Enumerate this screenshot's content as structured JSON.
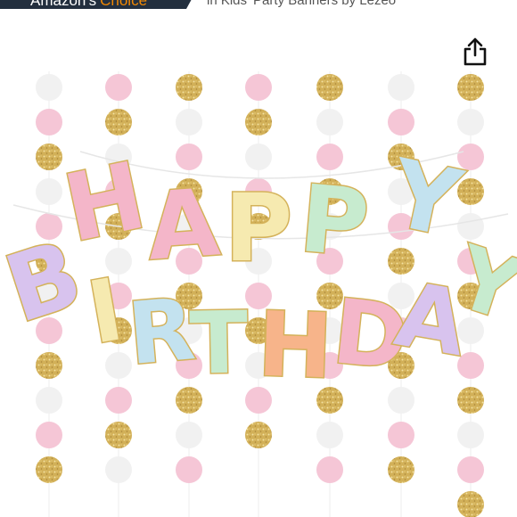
{
  "badge": {
    "word1": "Amazon's",
    "word2": "Choice"
  },
  "category_text": "in Kids' Party Banners by Lezeo",
  "share_icon": "share-icon",
  "product_image": {
    "letters": [
      "H",
      "A",
      "P",
      "P",
      "Y",
      "B",
      "I",
      "R",
      "T",
      "H",
      "D",
      "A",
      "Y"
    ],
    "colors": {
      "pink": "#f4b6c9",
      "lavender": "#d8c3ee",
      "yellow": "#f6eab0",
      "mint": "#c7ebcf",
      "blue": "#c3e2ef",
      "peach": "#f7b48a",
      "gold": "#d4b25a",
      "dot_pink": "#f5c6d6",
      "dot_white": "#f1f1f1"
    }
  }
}
